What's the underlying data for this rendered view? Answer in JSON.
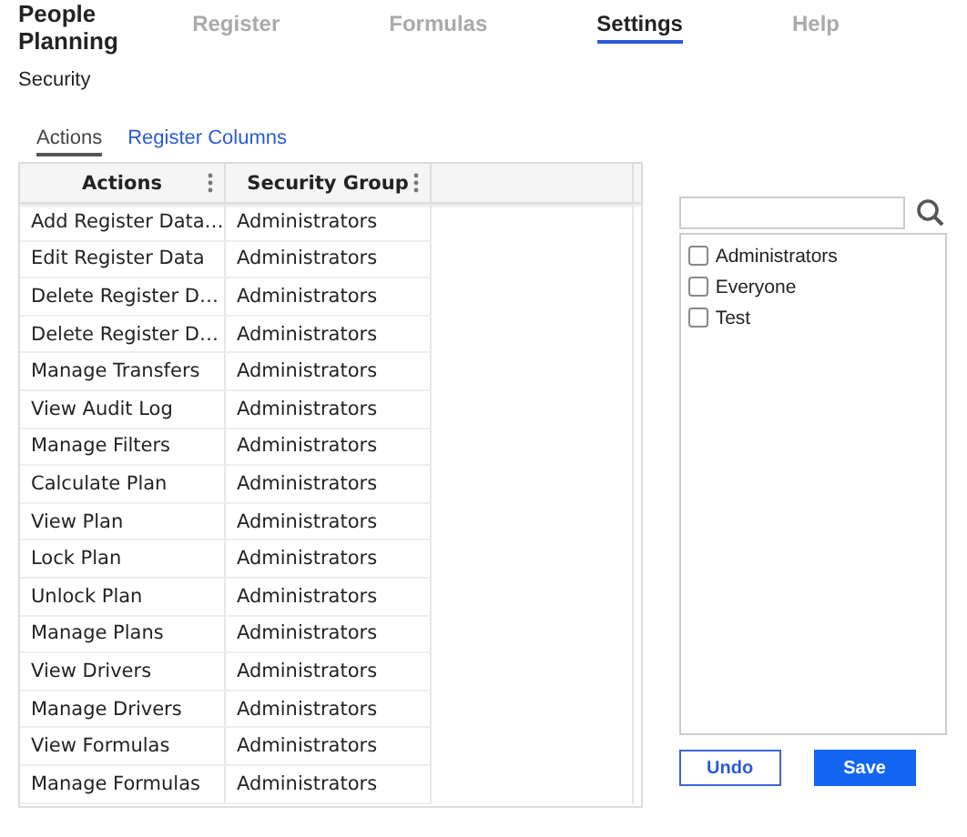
{
  "app_title": "People Planning",
  "nav": [
    {
      "label": "Register",
      "selected": false
    },
    {
      "label": "Formulas",
      "selected": false
    },
    {
      "label": "Settings",
      "selected": true
    },
    {
      "label": "Help",
      "selected": false
    }
  ],
  "page_title": "Security",
  "subtabs": [
    {
      "label": "Actions",
      "selected": true
    },
    {
      "label": "Register Columns",
      "selected": false
    }
  ],
  "table": {
    "columns": [
      "Actions",
      "Security Group"
    ],
    "rows": [
      [
        "Add Register Data…",
        "Administrators"
      ],
      [
        "Edit Register Data",
        "Administrators"
      ],
      [
        "Delete Register D…",
        "Administrators"
      ],
      [
        "Delete Register D…",
        "Administrators"
      ],
      [
        "Manage Transfers",
        "Administrators"
      ],
      [
        "View Audit Log",
        "Administrators"
      ],
      [
        "Manage Filters",
        "Administrators"
      ],
      [
        "Calculate Plan",
        "Administrators"
      ],
      [
        "View Plan",
        "Administrators"
      ],
      [
        "Lock Plan",
        "Administrators"
      ],
      [
        "Unlock Plan",
        "Administrators"
      ],
      [
        "Manage Plans",
        "Administrators"
      ],
      [
        "View Drivers",
        "Administrators"
      ],
      [
        "Manage Drivers",
        "Administrators"
      ],
      [
        "View Formulas",
        "Administrators"
      ],
      [
        "Manage Formulas",
        "Administrators"
      ]
    ]
  },
  "groups": [
    {
      "label": "Administrators",
      "checked": false
    },
    {
      "label": "Everyone",
      "checked": false
    },
    {
      "label": "Test",
      "checked": false
    }
  ],
  "buttons": [
    {
      "label": "Undo",
      "kind": "secondary"
    },
    {
      "label": "Save",
      "kind": "primary"
    }
  ]
}
